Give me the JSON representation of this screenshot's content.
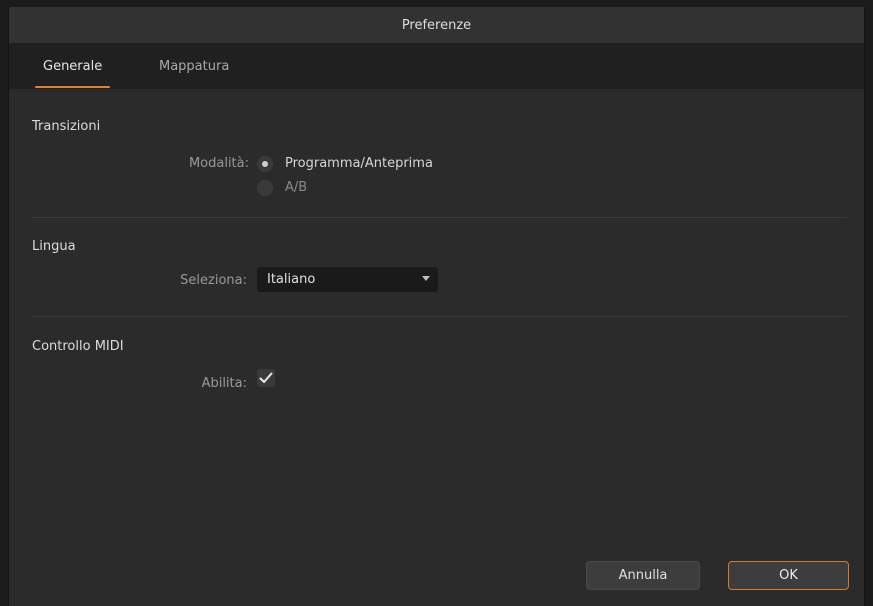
{
  "window": {
    "title": "Preferenze"
  },
  "tabs": [
    {
      "label": "Generale",
      "active": true
    },
    {
      "label": "Mappatura",
      "active": false
    }
  ],
  "sections": {
    "transitions": {
      "title": "Transizioni",
      "mode_label": "Modalità:",
      "options": [
        {
          "label": "Programma/Anteprima",
          "selected": true
        },
        {
          "label": "A/B",
          "selected": false
        }
      ]
    },
    "language": {
      "title": "Lingua",
      "select_label": "Seleziona:",
      "selected_value": "Italiano"
    },
    "midi": {
      "title": "Controllo MIDI",
      "enable_label": "Abilita:",
      "enabled": true
    }
  },
  "footer": {
    "cancel_label": "Annulla",
    "ok_label": "OK"
  },
  "colors": {
    "accent": "#e6812a",
    "background": "#2b2b2b",
    "tabbar": "#202020"
  }
}
